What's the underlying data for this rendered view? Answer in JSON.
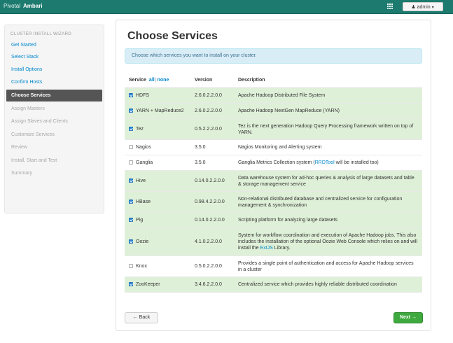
{
  "topbar": {
    "brand_pivotal": "Pivotal",
    "brand_ambari": "Ambari",
    "admin_label": "admin"
  },
  "sidebar": {
    "heading": "CLUSTER INSTALL WIZARD",
    "items": [
      {
        "label": "Get Started",
        "state": "link"
      },
      {
        "label": "Select Stack",
        "state": "link"
      },
      {
        "label": "Install Options",
        "state": "link"
      },
      {
        "label": "Confirm Hosts",
        "state": "link"
      },
      {
        "label": "Choose Services",
        "state": "active"
      },
      {
        "label": "Assign Masters",
        "state": "disabled"
      },
      {
        "label": "Assign Slaves and Clients",
        "state": "disabled"
      },
      {
        "label": "Customize Services",
        "state": "disabled"
      },
      {
        "label": "Review",
        "state": "disabled"
      },
      {
        "label": "Install, Start and Test",
        "state": "disabled"
      },
      {
        "label": "Summary",
        "state": "disabled"
      }
    ]
  },
  "main": {
    "title": "Choose Services",
    "info": "Choose which services you want to install on your cluster.",
    "table": {
      "headers": {
        "service": "Service",
        "all": "all",
        "sep": "|",
        "none": "none",
        "version": "Version",
        "description": "Description"
      },
      "rows": [
        {
          "service": "HDFS",
          "checked": true,
          "version": "2.6.0.2.2.0.0",
          "description": "Apache Hadoop Distributed File System"
        },
        {
          "service": "YARN + MapReduce2",
          "checked": true,
          "version": "2.6.0.2.2.0.0",
          "description": "Apache Hadoop NextGen MapReduce (YARN)"
        },
        {
          "service": "Tez",
          "checked": true,
          "version": "0.5.2.2.2.0.0",
          "description": "Tez is the next generation Hadoop Query Processing framework written on top of YARN."
        },
        {
          "service": "Nagios",
          "checked": false,
          "version": "3.5.0",
          "description": "Nagios Monitoring and Alerting system"
        },
        {
          "service": "Ganglia",
          "checked": false,
          "version": "3.5.0",
          "description_pre": "Ganglia Metrics Collection system (",
          "description_link": "RRDTool",
          "description_post": " will be installed too)"
        },
        {
          "service": "Hive",
          "checked": true,
          "version": "0.14.0.2.2.0.0",
          "description": "Data warehouse system for ad-hoc queries & analysis of large datasets and table & storage management service"
        },
        {
          "service": "HBase",
          "checked": true,
          "version": "0.98.4.2.2.0.0",
          "description": "Non-relational distributed database and centralized service for configuration management & synchronization"
        },
        {
          "service": "Pig",
          "checked": true,
          "version": "0.14.0.2.2.0.0",
          "description": "Scripting platform for analyzing large datasets"
        },
        {
          "service": "Oozie",
          "checked": true,
          "version": "4.1.0.2.2.0.0",
          "description_pre": "System for workflow coordination and execution of Apache Hadoop jobs. This also includes the installation of the optional Oozie Web Console which relies on and will install the ",
          "description_link": "ExtJS",
          "description_post": " Library."
        },
        {
          "service": "Knox",
          "checked": false,
          "version": "0.5.0.2.2.0.0",
          "description": "Provides a single point of authentication and access for Apache Hadoop services in a cluster"
        },
        {
          "service": "ZooKeeper",
          "checked": true,
          "version": "3.4.6.2.2.0.0",
          "description": "Centralized service which provides highly reliable distributed coordination"
        }
      ]
    },
    "back_label": "← Back",
    "next_label": "Next →"
  }
}
